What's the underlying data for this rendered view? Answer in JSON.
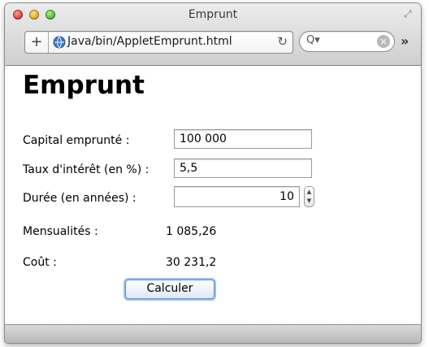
{
  "window": {
    "title": "Emprunt"
  },
  "toolbar": {
    "new_tab_label": "+",
    "url": "Java/bin/AppletEmprunt.html",
    "search_placeholder": "Q▾",
    "overflow_label": "»"
  },
  "page": {
    "heading": "Emprunt",
    "fields": {
      "capital_label": "Capital emprunté :",
      "capital_value": "100 000",
      "taux_label": "Taux d'intérêt (en %) :",
      "taux_value": "5,5",
      "duree_label": "Durée (en années) :",
      "duree_value": "10"
    },
    "results": {
      "mensualites_label": "Mensualités :",
      "mensualites_value": "1 085,26",
      "cout_label": "Coût :",
      "cout_value": "30 231,2"
    },
    "calculate_label": "Calculer"
  },
  "colors": {
    "button_focus": "#9bc0ee",
    "button_border": "#5c8fd6"
  },
  "icons": {
    "globe": "globe-icon",
    "reload": "reload-icon",
    "search": "search-icon",
    "clear": "clear-icon",
    "fullscreen": "fullscreen-icon"
  }
}
